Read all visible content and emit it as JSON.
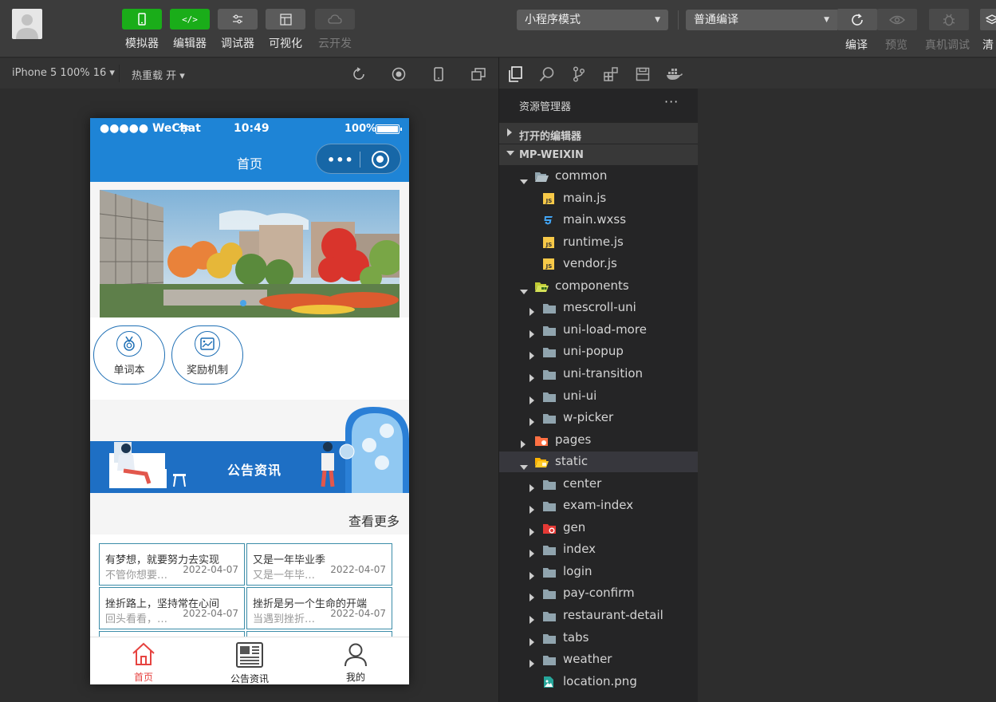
{
  "toolbar": {
    "tools": [
      {
        "label": "模拟器",
        "active": true
      },
      {
        "label": "编辑器",
        "active": true
      },
      {
        "label": "调试器",
        "active": false
      },
      {
        "label": "可视化",
        "active": false
      },
      {
        "label": "云开发",
        "active": false,
        "disabled": true
      }
    ],
    "mode_select": "小程序模式",
    "compile_select": "普通编译",
    "actions": [
      {
        "label": "编译",
        "disabled": false
      },
      {
        "label": "预览",
        "disabled": true
      },
      {
        "label": "真机调试",
        "disabled": true
      },
      {
        "label": "清",
        "disabled": false
      }
    ]
  },
  "simulator": {
    "device": "iPhone 5 100% 16 ▾",
    "hot_reload": "热重载 开 ▾"
  },
  "phone": {
    "status": {
      "carrier": "●●●●● WeChat",
      "time": "10:49",
      "battery": "100%"
    },
    "nav_title": "首页",
    "capsule_dots": "•••",
    "quick_items": [
      {
        "label": "单词本",
        "icon": "medal-icon"
      },
      {
        "label": "奖励机制",
        "icon": "chart-image-icon"
      }
    ],
    "notice_title": "公告资讯",
    "more": "查看更多",
    "news": [
      {
        "title": "有梦想，就要努力去实现",
        "summary": "不管你想要…",
        "date": "2022-04-07"
      },
      {
        "title": "又是一年毕业季",
        "summary": "又是一年毕…",
        "date": "2022-04-07"
      },
      {
        "title": "挫折路上，坚持常在心间",
        "summary": "回头看看，…",
        "date": "2022-04-07"
      },
      {
        "title": "挫折是另一个生命的开端",
        "summary": "当遇到挫折…",
        "date": "2022-04-07"
      }
    ],
    "tabs": [
      {
        "label": "首页",
        "icon": "home-icon",
        "active": true
      },
      {
        "label": "公告资讯",
        "icon": "newspaper-icon",
        "active": false
      },
      {
        "label": "我的",
        "icon": "user-icon",
        "active": false
      }
    ]
  },
  "explorer": {
    "title": "资源管理器",
    "more": "···",
    "sections": [
      {
        "label": "打开的编辑器",
        "expanded": false
      },
      {
        "label": "MP-WEIXIN",
        "expanded": true
      }
    ],
    "tree": [
      {
        "name": "common",
        "type": "folder-open",
        "depth": 1
      },
      {
        "name": "main.js",
        "type": "js",
        "depth": 2
      },
      {
        "name": "main.wxss",
        "type": "css",
        "depth": 2
      },
      {
        "name": "runtime.js",
        "type": "js",
        "depth": 2
      },
      {
        "name": "vendor.js",
        "type": "js",
        "depth": 2
      },
      {
        "name": "components",
        "type": "folder-components-open",
        "depth": 1
      },
      {
        "name": "mescroll-uni",
        "type": "folder",
        "depth": 2
      },
      {
        "name": "uni-load-more",
        "type": "folder",
        "depth": 2
      },
      {
        "name": "uni-popup",
        "type": "folder",
        "depth": 2
      },
      {
        "name": "uni-transition",
        "type": "folder",
        "depth": 2
      },
      {
        "name": "uni-ui",
        "type": "folder",
        "depth": 2
      },
      {
        "name": "w-picker",
        "type": "folder",
        "depth": 2
      },
      {
        "name": "pages",
        "type": "folder-pages",
        "depth": 1
      },
      {
        "name": "static",
        "type": "folder-static-open",
        "depth": 1,
        "selected": true
      },
      {
        "name": "center",
        "type": "folder",
        "depth": 2
      },
      {
        "name": "exam-index",
        "type": "folder",
        "depth": 2
      },
      {
        "name": "gen",
        "type": "folder-gen",
        "depth": 2
      },
      {
        "name": "index",
        "type": "folder",
        "depth": 2
      },
      {
        "name": "login",
        "type": "folder",
        "depth": 2
      },
      {
        "name": "pay-confirm",
        "type": "folder",
        "depth": 2
      },
      {
        "name": "restaurant-detail",
        "type": "folder",
        "depth": 2
      },
      {
        "name": "tabs",
        "type": "folder",
        "depth": 2
      },
      {
        "name": "weather",
        "type": "folder",
        "depth": 2
      },
      {
        "name": "location.png",
        "type": "image",
        "depth": 2
      }
    ]
  },
  "colors": {
    "primary_blue": "#1e84d6",
    "green": "#1aad19",
    "active_tab": "#e64340",
    "card_border": "#3b8ca8"
  }
}
